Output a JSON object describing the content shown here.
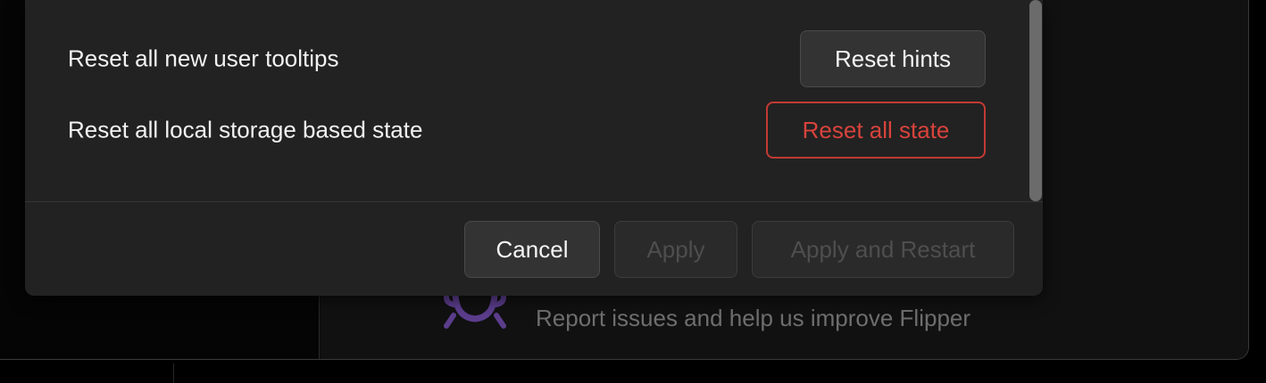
{
  "settings": {
    "rows": [
      {
        "label": "Reset all new user tooltips",
        "button_label": "Reset hints"
      },
      {
        "label": "Reset all local storage based state",
        "button_label": "Reset all state"
      }
    ]
  },
  "footer": {
    "cancel_label": "Cancel",
    "apply_label": "Apply",
    "apply_restart_label": "Apply and Restart"
  },
  "background": {
    "report_text": "Report issues and help us improve Flipper",
    "report_icon": "bug-icon"
  },
  "colors": {
    "danger": "#d8433c",
    "dialog_bg": "#222222",
    "bug_icon": "#5b3d8c"
  }
}
